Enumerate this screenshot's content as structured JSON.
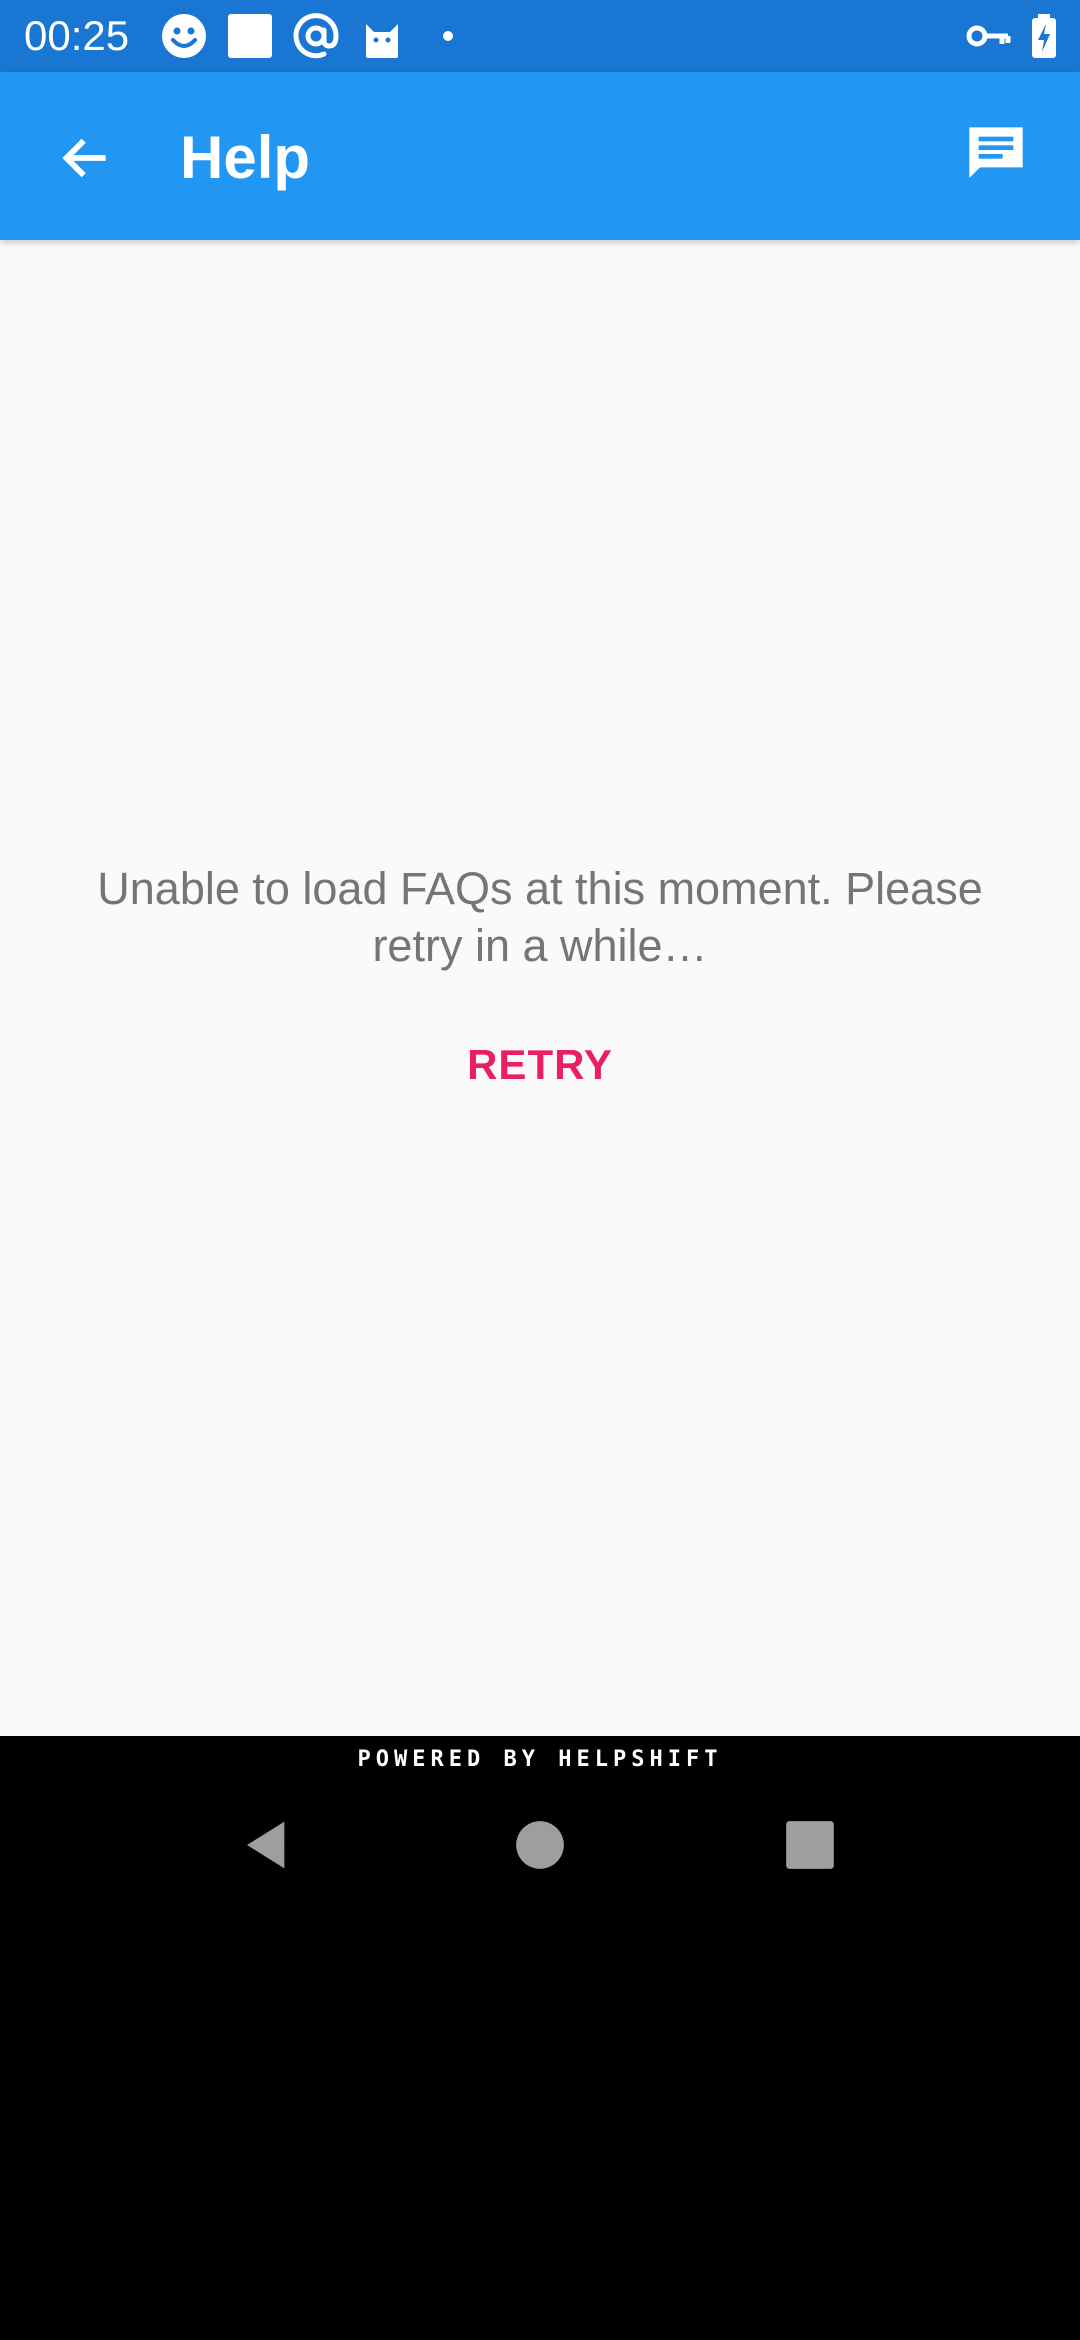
{
  "status_bar": {
    "time": "00:25",
    "left_icons": [
      "smiley-icon",
      "white-square-icon",
      "at-sign-icon",
      "cat-icon",
      "dot-icon"
    ],
    "right_icons": [
      "vpn-key-icon",
      "battery-charging-icon"
    ],
    "background": "#1976D2"
  },
  "app_bar": {
    "title": "Help",
    "background": "#2196F3",
    "back_icon": "arrow-back-icon",
    "action_icon": "chat-icon"
  },
  "content": {
    "error_message": "Unable to load FAQs at this moment. Please retry in a while…",
    "retry_label": "RETRY",
    "retry_color": "#E91E63"
  },
  "footer": {
    "powered_by": "POWERED BY HELPSHIFT"
  },
  "nav_bar": {
    "buttons": [
      "back-triangle-icon",
      "home-circle-icon",
      "recents-square-icon"
    ]
  }
}
